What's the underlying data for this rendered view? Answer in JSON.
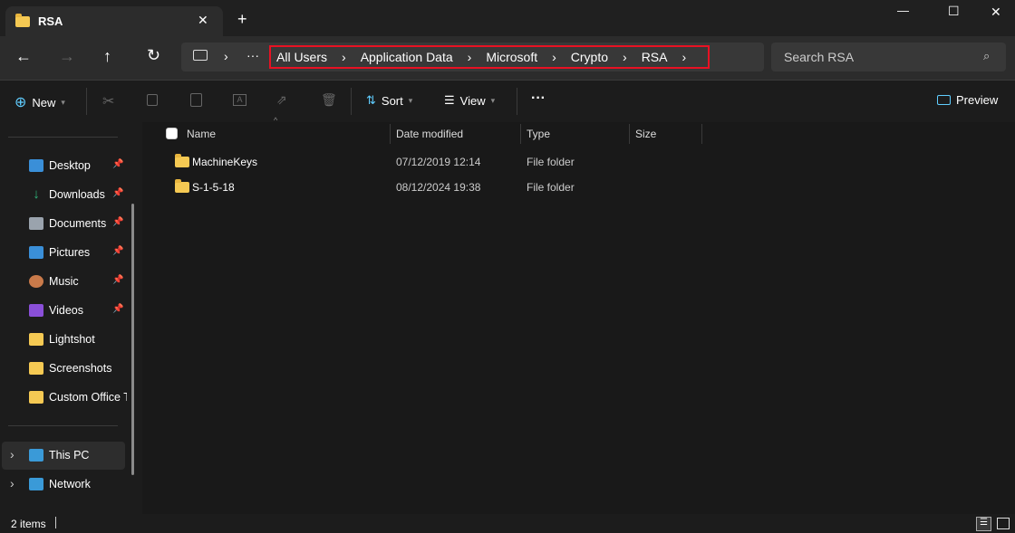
{
  "window": {
    "tab_title": "RSA",
    "new_tab": "+",
    "controls": {
      "minimize": "—",
      "maximize": "☐",
      "close": "✕"
    }
  },
  "nav": {
    "back": "←",
    "forward": "→",
    "up": "↑",
    "refresh": "↻",
    "more": "···"
  },
  "breadcrumb": [
    "All Users",
    "Application Data",
    "Microsoft",
    "Crypto",
    "RSA"
  ],
  "search": {
    "placeholder": "Search RSA"
  },
  "toolbar": {
    "new": "New",
    "sort": "Sort",
    "view": "View",
    "more": "···",
    "preview": "Preview"
  },
  "sidebar": {
    "quick_access": [
      {
        "label": "Desktop",
        "icon": "desktop-icon",
        "pinned": true
      },
      {
        "label": "Downloads",
        "icon": "download-icon",
        "pinned": true
      },
      {
        "label": "Documents",
        "icon": "documents-icon",
        "pinned": true
      },
      {
        "label": "Pictures",
        "icon": "pictures-icon",
        "pinned": true
      },
      {
        "label": "Music",
        "icon": "music-icon",
        "pinned": true
      },
      {
        "label": "Videos",
        "icon": "videos-icon",
        "pinned": true
      },
      {
        "label": "Lightshot",
        "icon": "folder-icon",
        "pinned": false
      },
      {
        "label": "Screenshots",
        "icon": "folder-icon",
        "pinned": false
      },
      {
        "label": "Custom Office T",
        "icon": "folder-icon",
        "pinned": false
      }
    ],
    "locations": [
      {
        "label": "This PC",
        "selected": true
      },
      {
        "label": "Network",
        "selected": false
      }
    ]
  },
  "columns": [
    "Name",
    "Date modified",
    "Type",
    "Size"
  ],
  "files": [
    {
      "name": "MachineKeys",
      "date": "07/12/2019 12:14",
      "type": "File folder",
      "size": ""
    },
    {
      "name": "S-1-5-18",
      "date": "08/12/2024 19:38",
      "type": "File folder",
      "size": ""
    }
  ],
  "status": {
    "count": "2 items"
  },
  "colors": {
    "highlight": "#e81123",
    "folder": "#f5c953",
    "accent": "#60cdff"
  }
}
